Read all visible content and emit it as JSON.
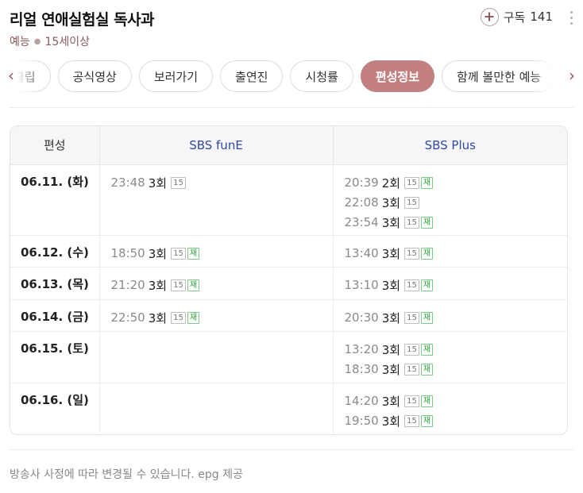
{
  "program": {
    "title": "리얼 연애실험실 독사과",
    "genre": "예능",
    "rating": "15세이상",
    "subscribe_label": "구독",
    "subscribe_count": "141"
  },
  "tabs": [
    {
      "label": "클립"
    },
    {
      "label": "공식영상"
    },
    {
      "label": "보러가기"
    },
    {
      "label": "출연진"
    },
    {
      "label": "시청률"
    },
    {
      "label": "편성정보",
      "active": true
    },
    {
      "label": "함께 볼만한 예능"
    }
  ],
  "schedule": {
    "header": {
      "date": "편성",
      "ch1": "SBS funE",
      "ch2": "SBS Plus"
    },
    "rows": [
      {
        "date": "06.11. (화)",
        "ch1": [
          {
            "time": "23:48",
            "ep": "3회",
            "rating": "15",
            "re": ""
          }
        ],
        "ch2": [
          {
            "time": "20:39",
            "ep": "2회",
            "rating": "15",
            "re": "재"
          },
          {
            "time": "22:08",
            "ep": "3회",
            "rating": "15",
            "re": ""
          },
          {
            "time": "23:54",
            "ep": "3회",
            "rating": "15",
            "re": "재"
          }
        ]
      },
      {
        "date": "06.12. (수)",
        "ch1": [
          {
            "time": "18:50",
            "ep": "3회",
            "rating": "15",
            "re": "재"
          }
        ],
        "ch2": [
          {
            "time": "13:40",
            "ep": "3회",
            "rating": "15",
            "re": "재"
          }
        ]
      },
      {
        "date": "06.13. (목)",
        "ch1": [
          {
            "time": "21:20",
            "ep": "3회",
            "rating": "15",
            "re": "재"
          }
        ],
        "ch2": [
          {
            "time": "13:10",
            "ep": "3회",
            "rating": "15",
            "re": "재"
          }
        ]
      },
      {
        "date": "06.14. (금)",
        "ch1": [
          {
            "time": "22:50",
            "ep": "3회",
            "rating": "15",
            "re": "재"
          }
        ],
        "ch2": [
          {
            "time": "20:30",
            "ep": "3회",
            "rating": "15",
            "re": "재"
          }
        ]
      },
      {
        "date": "06.15. (토)",
        "ch1": [],
        "ch2": [
          {
            "time": "13:20",
            "ep": "3회",
            "rating": "15",
            "re": "재"
          },
          {
            "time": "18:30",
            "ep": "3회",
            "rating": "15",
            "re": "재"
          }
        ]
      },
      {
        "date": "06.16. (일)",
        "ch1": [],
        "ch2": [
          {
            "time": "14:20",
            "ep": "3회",
            "rating": "15",
            "re": "재"
          },
          {
            "time": "19:50",
            "ep": "3회",
            "rating": "15",
            "re": "재"
          }
        ]
      }
    ]
  },
  "footer": {
    "note": "방송사 사정에 따라 변경될 수 있습니다. epg 제공"
  },
  "colors": {
    "accent": "#c38080",
    "channel": "#2f49a3",
    "rerun": "#27a33a"
  }
}
